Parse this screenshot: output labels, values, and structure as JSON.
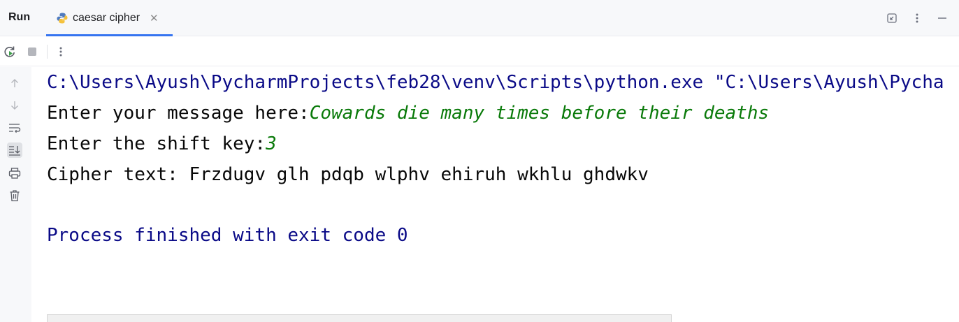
{
  "header": {
    "run_label": "Run",
    "tab_label": "caesar cipher"
  },
  "console": {
    "command_line": "C:\\Users\\Ayush\\PycharmProjects\\feb28\\venv\\Scripts\\python.exe \"C:\\Users\\Ayush\\Pycha",
    "prompt_message": "Enter your message here:",
    "input_message": "Cowards die many times before their deaths",
    "prompt_shift": "Enter the shift key:",
    "input_shift": "3",
    "cipher_output": "Cipher text: Frzdugv glh pdqb wlphv ehiruh wkhlu ghdwkv",
    "exit_message": "Process finished with exit code 0"
  },
  "colors": {
    "system_text": "#0a0a87",
    "user_input": "#0a7a0a",
    "accent": "#3574f0"
  }
}
